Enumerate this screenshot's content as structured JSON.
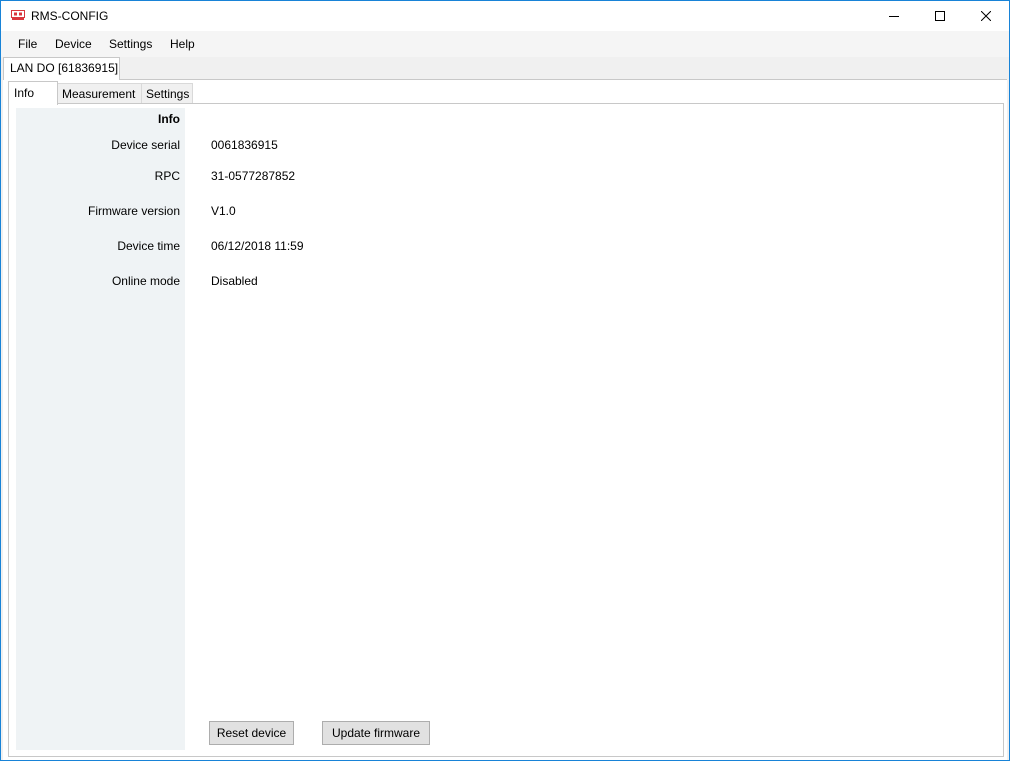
{
  "window": {
    "title": "RMS-CONFIG"
  },
  "menu": {
    "file": "File",
    "device": "Device",
    "settings": "Settings",
    "help": "Help"
  },
  "document_tab": {
    "label": "LAN DO [61836915]"
  },
  "tabs": {
    "info": "Info",
    "measurement": "Measurement",
    "settings": "Settings"
  },
  "info": {
    "section_title": "Info",
    "fields": [
      {
        "label": "Device serial",
        "value": "0061836915"
      },
      {
        "label": "RPC",
        "value": "31-0577287852"
      },
      {
        "label": "Firmware version",
        "value": "V1.0"
      },
      {
        "label": "Device time",
        "value": "06/12/2018 11:59"
      },
      {
        "label": "Online mode",
        "value": "Disabled"
      }
    ]
  },
  "buttons": {
    "reset": "Reset device",
    "update": "Update firmware"
  },
  "icons": {
    "app": "app-icon",
    "minimize": "minimize-icon",
    "maximize": "maximize-icon",
    "close": "close-icon"
  },
  "colors": {
    "window_border": "#1883d7",
    "label_column": "#eff3f5",
    "button_face": "#e1e1e1",
    "app_icon": "#d9363e"
  }
}
